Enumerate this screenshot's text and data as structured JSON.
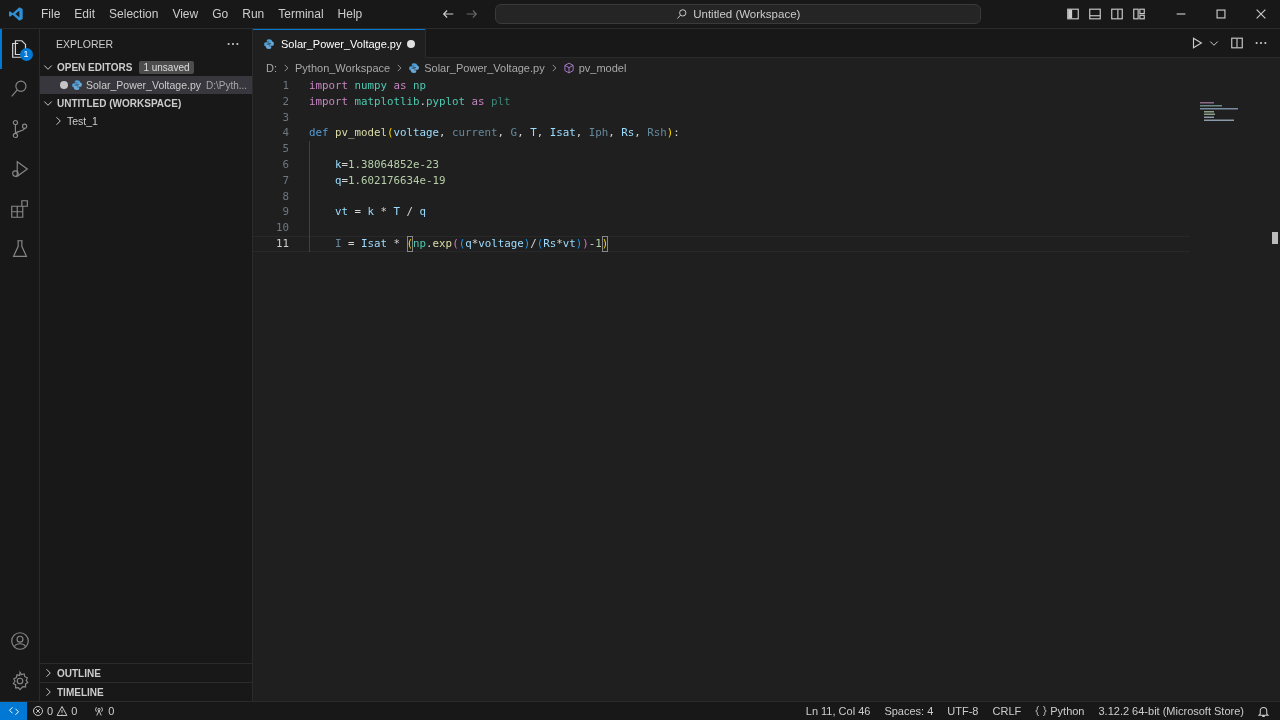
{
  "window": {
    "menu": [
      "File",
      "Edit",
      "Selection",
      "View",
      "Go",
      "Run",
      "Terminal",
      "Help"
    ],
    "command_center": "Untitled (Workspace)"
  },
  "activity_bar": {
    "items": [
      {
        "kind": "explorer",
        "selected": true,
        "badge": "1"
      },
      {
        "kind": "search",
        "selected": false
      },
      {
        "kind": "source-control",
        "selected": false
      },
      {
        "kind": "run",
        "selected": false
      },
      {
        "kind": "extensions",
        "selected": false
      },
      {
        "kind": "testing",
        "selected": false
      }
    ]
  },
  "sidebar": {
    "title": "EXPLORER",
    "sections": [
      {
        "kind": "open-editors",
        "title": "OPEN EDITORS",
        "badge": "1 unsaved",
        "expanded": true,
        "items": [
          {
            "name": "Solar_Power_Voltage.py",
            "path": "D:\\Pyth...",
            "modified": true,
            "selected": true
          }
        ]
      },
      {
        "kind": "folder",
        "title": "UNTITLED (WORKSPACE)",
        "expanded": true,
        "items": [
          {
            "name": "Test_1",
            "expanded": false
          }
        ]
      }
    ],
    "bottom_sections": [
      {
        "title": "OUTLINE",
        "expanded": false
      },
      {
        "title": "TIMELINE",
        "expanded": false
      }
    ]
  },
  "tabs": [
    {
      "label": "Solar_Power_Voltage.py",
      "modified": true,
      "selected": true
    }
  ],
  "breadcrumb": [
    {
      "kind": "text",
      "label": "D:"
    },
    {
      "kind": "text",
      "label": "Python_Workspace"
    },
    {
      "kind": "python-file",
      "label": "Solar_Power_Voltage.py"
    },
    {
      "kind": "symbol",
      "label": "pv_model"
    }
  ],
  "code": [
    {
      "number": "1",
      "current": false,
      "indented": false,
      "tokens": [
        {
          "t": "import ",
          "kind": "kw"
        },
        {
          "t": "numpy ",
          "kind": "mod"
        },
        {
          "t": "as ",
          "kind": "kw"
        },
        {
          "t": "np",
          "kind": "mod"
        }
      ]
    },
    {
      "number": "2",
      "current": false,
      "indented": false,
      "tokens": [
        {
          "t": "import ",
          "kind": "kw"
        },
        {
          "t": "matplotlib",
          "kind": "mod"
        },
        {
          "t": ".",
          "kind": "op"
        },
        {
          "t": "pyplot ",
          "kind": "mod"
        },
        {
          "t": "as ",
          "kind": "kw"
        },
        {
          "t": "plt",
          "kind": "dimmod"
        }
      ]
    },
    {
      "number": "3",
      "current": false,
      "indented": false
    },
    {
      "number": "4",
      "current": false,
      "indented": false,
      "tokens": [
        {
          "t": "def ",
          "kind": "def"
        },
        {
          "t": "pv_model",
          "kind": "fn"
        },
        {
          "t": "(",
          "kind": "br1"
        },
        {
          "t": "voltage",
          "kind": "var"
        },
        {
          "t": ", ",
          "kind": "op"
        },
        {
          "t": "current",
          "kind": "dim"
        },
        {
          "t": ", ",
          "kind": "op"
        },
        {
          "t": "G",
          "kind": "dim"
        },
        {
          "t": ", ",
          "kind": "op"
        },
        {
          "t": "T",
          "kind": "var"
        },
        {
          "t": ", ",
          "kind": "op"
        },
        {
          "t": "Isat",
          "kind": "var"
        },
        {
          "t": ", ",
          "kind": "op"
        },
        {
          "t": "Iph",
          "kind": "dim"
        },
        {
          "t": ", ",
          "kind": "op"
        },
        {
          "t": "Rs",
          "kind": "var"
        },
        {
          "t": ", ",
          "kind": "op"
        },
        {
          "t": "Rsh",
          "kind": "dim"
        },
        {
          "t": ")",
          "kind": "br1"
        },
        {
          "t": ":",
          "kind": "op"
        }
      ]
    },
    {
      "number": "5",
      "current": false,
      "indented": true
    },
    {
      "number": "6",
      "current": false,
      "indented": true,
      "tokens": [
        {
          "t": "k",
          "kind": "var"
        },
        {
          "t": "=",
          "kind": "op"
        },
        {
          "t": "1.38064852e-23",
          "kind": "num"
        }
      ]
    },
    {
      "number": "7",
      "current": false,
      "indented": true,
      "tokens": [
        {
          "t": "q",
          "kind": "var"
        },
        {
          "t": "=",
          "kind": "op"
        },
        {
          "t": "1.602176634e-19",
          "kind": "num"
        }
      ]
    },
    {
      "number": "8",
      "current": false,
      "indented": true
    },
    {
      "number": "9",
      "current": false,
      "indented": true,
      "tokens": [
        {
          "t": "vt",
          "kind": "var"
        },
        {
          "t": " = ",
          "kind": "op"
        },
        {
          "t": "k",
          "kind": "var"
        },
        {
          "t": " * ",
          "kind": "op"
        },
        {
          "t": "T",
          "kind": "var"
        },
        {
          "t": " / ",
          "kind": "op"
        },
        {
          "t": "q",
          "kind": "var"
        }
      ]
    },
    {
      "number": "10",
      "current": false,
      "indented": true
    },
    {
      "number": "11",
      "current": true,
      "indented": true,
      "tokens": [
        {
          "t": "I",
          "kind": "dim"
        },
        {
          "t": " = ",
          "kind": "op"
        },
        {
          "t": "Isat",
          "kind": "var"
        },
        {
          "t": " * ",
          "kind": "op"
        },
        {
          "t": "(",
          "kind": "brmatch"
        },
        {
          "t": "np",
          "kind": "mod"
        },
        {
          "t": ".",
          "kind": "op"
        },
        {
          "t": "exp",
          "kind": "fn"
        },
        {
          "t": "(",
          "kind": "br2"
        },
        {
          "t": "(",
          "kind": "br3"
        },
        {
          "t": "q",
          "kind": "var"
        },
        {
          "t": "*",
          "kind": "op"
        },
        {
          "t": "voltage",
          "kind": "var"
        },
        {
          "t": ")",
          "kind": "br3"
        },
        {
          "t": "/",
          "kind": "op"
        },
        {
          "t": "(",
          "kind": "br3"
        },
        {
          "t": "Rs",
          "kind": "var"
        },
        {
          "t": "*",
          "kind": "op"
        },
        {
          "t": "vt",
          "kind": "var"
        },
        {
          "t": ")",
          "kind": "br3"
        },
        {
          "t": ")",
          "kind": "br2"
        },
        {
          "t": "-",
          "kind": "op"
        },
        {
          "t": "1",
          "kind": "num"
        },
        {
          "t": ")",
          "kind": "brmatch"
        }
      ]
    }
  ],
  "status_bar": {
    "errors": "0",
    "warnings": "0",
    "ports": "0",
    "right": [
      {
        "kind": "text",
        "label": "Ln 11, Col 46"
      },
      {
        "kind": "text",
        "label": "Spaces: 4"
      },
      {
        "kind": "text",
        "label": "UTF-8"
      },
      {
        "kind": "text",
        "label": "CRLF"
      },
      {
        "kind": "language",
        "label": "Python"
      },
      {
        "kind": "text",
        "label": "3.12.2 64-bit (Microsoft Store)"
      }
    ]
  }
}
